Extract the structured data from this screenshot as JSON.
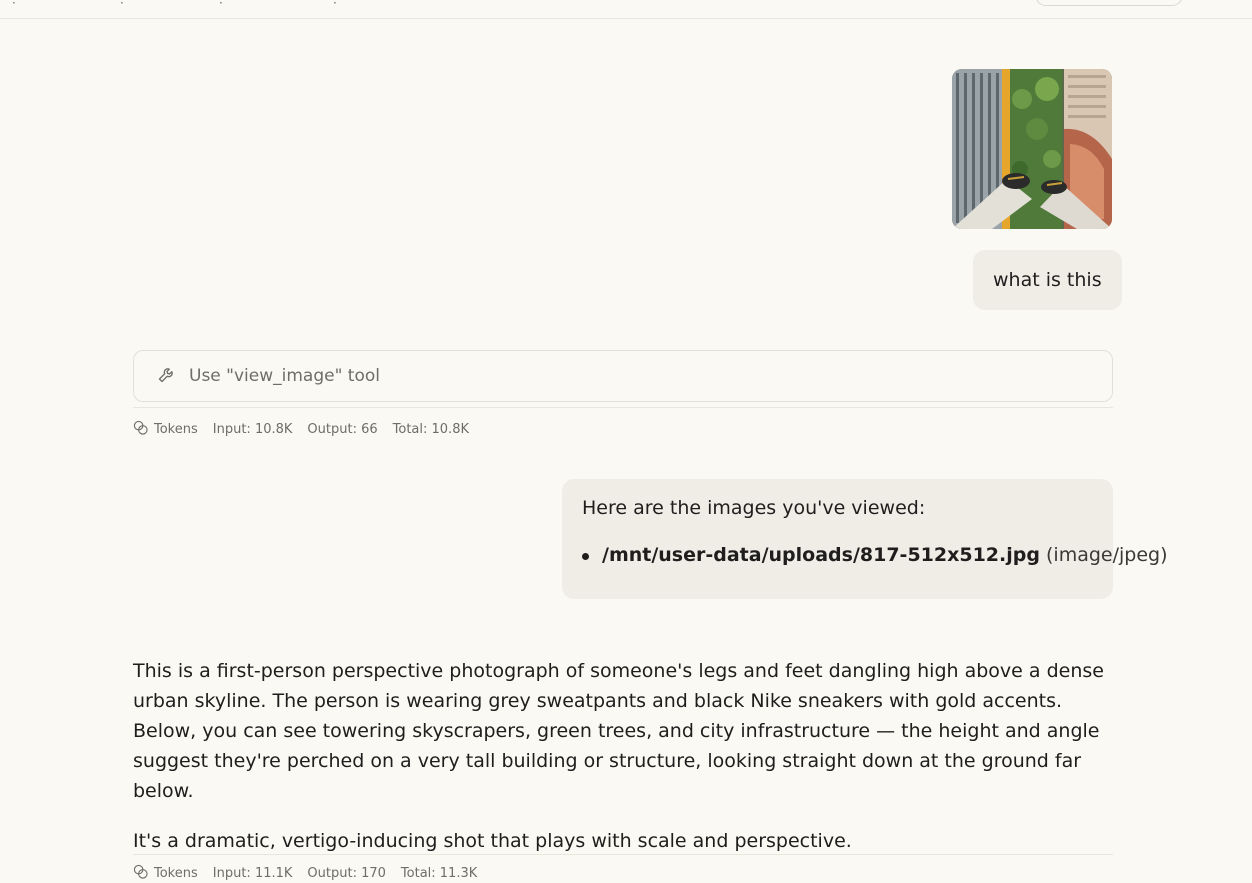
{
  "topbar": {
    "fragments": [
      "·",
      "·",
      "·",
      "·"
    ]
  },
  "user_message": {
    "image_alt": "City skyline photo",
    "text": "what is this"
  },
  "tool_call": {
    "label": "Use \"view_image\" tool",
    "icon": "wrench-icon"
  },
  "tokens_1": {
    "label": "Tokens",
    "input": "Input: 10.8K",
    "output": "Output: 66",
    "total": "Total: 10.8K"
  },
  "viewed_images": {
    "heading": "Here are the images you've viewed:",
    "items": [
      {
        "path": "/mnt/user-data/uploads/817-512x512.jpg",
        "mime": "(image/jpeg)"
      }
    ]
  },
  "answer": {
    "p1": "This is a first-person perspective photograph of someone's legs and feet dangling high above a dense urban skyline. The person is wearing grey sweatpants and black Nike sneakers with gold accents. Below, you can see towering skyscrapers, green trees, and city infrastructure — the height and angle suggest they're perched on a very tall building or structure, looking straight down at the ground far below.",
    "p2": "It's a dramatic, vertigo-inducing shot that plays with scale and perspective."
  },
  "tokens_2": {
    "label": "Tokens",
    "input": "Input: 11.1K",
    "output": "Output: 170",
    "total": "Total: 11.3K"
  },
  "colors": {
    "background": "#faf9f4",
    "bubble": "#f0ede7",
    "text": "#1f1e1d",
    "muted": "#6e6d68"
  }
}
